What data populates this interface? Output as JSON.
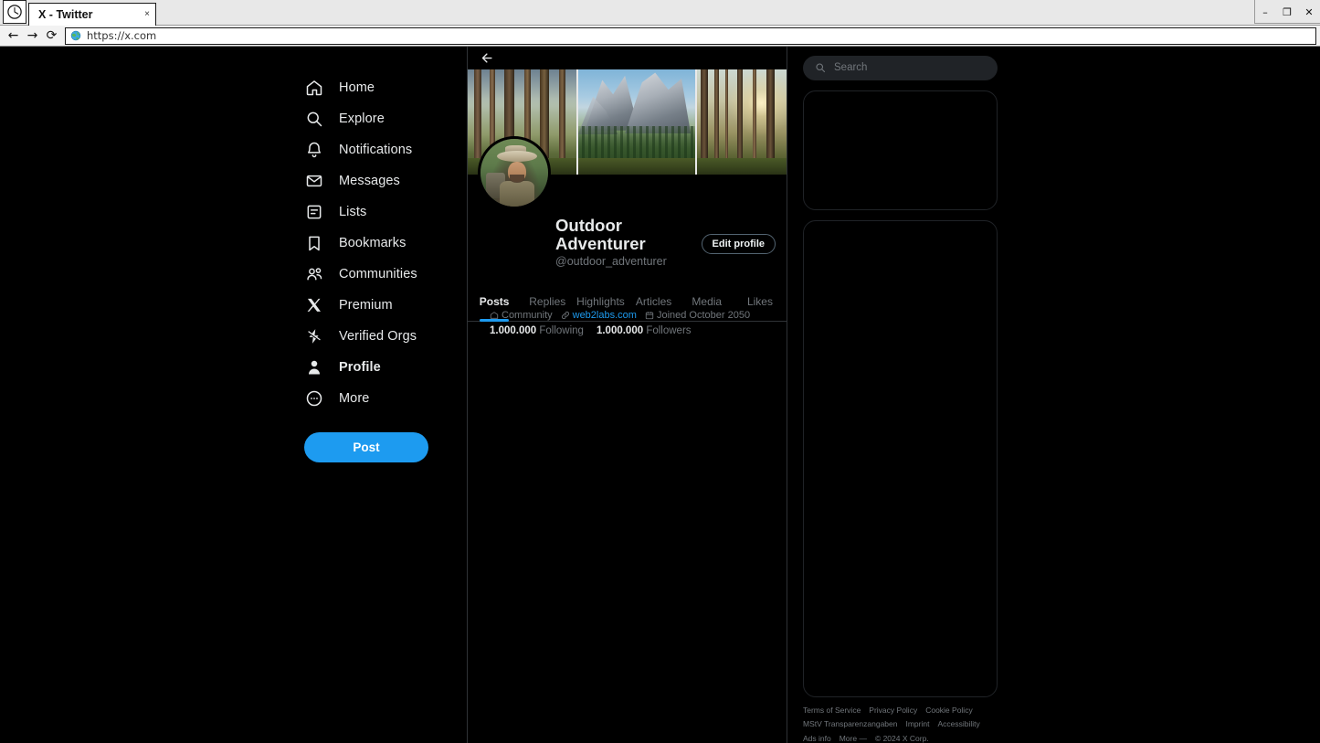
{
  "browser": {
    "app_icon": "clock-icon",
    "tab_title": "X - Twitter",
    "tab_close": "×",
    "url": "https://x.com",
    "back_icon": "←",
    "forward_icon": "→",
    "reload_icon": "⟳",
    "minimize": "–",
    "maximize": "❐",
    "close": "✕"
  },
  "sidebar": {
    "items": [
      {
        "label": "Home",
        "icon": "home-icon",
        "active": false
      },
      {
        "label": "Explore",
        "icon": "search-icon",
        "active": false
      },
      {
        "label": "Notifications",
        "icon": "bell-icon",
        "active": false
      },
      {
        "label": "Messages",
        "icon": "envelope-icon",
        "active": false
      },
      {
        "label": "Lists",
        "icon": "list-icon",
        "active": false
      },
      {
        "label": "Bookmarks",
        "icon": "bookmark-icon",
        "active": false
      },
      {
        "label": "Communities",
        "icon": "people-icon",
        "active": false
      },
      {
        "label": "Premium",
        "icon": "x-logo-icon",
        "active": false
      },
      {
        "label": "Verified Orgs",
        "icon": "lightning-badge-icon",
        "active": false
      },
      {
        "label": "Profile",
        "icon": "person-icon",
        "active": true
      },
      {
        "label": "More",
        "icon": "more-circle-icon",
        "active": false
      }
    ],
    "post_label": "Post"
  },
  "profile": {
    "back_icon": "back-arrow-icon",
    "banner_alt": "forest-and-mountain-banner",
    "avatar_alt": "outdoor-adventurer-avatar",
    "display_name": "Outdoor Adventurer",
    "handle": "@outdoor_adventurer",
    "edit_profile_label": "Edit profile",
    "meta": {
      "community_label": "Community",
      "community_icon": "community-icon",
      "website": "web2labs.com",
      "website_icon": "link-icon",
      "joined": "Joined October 2050",
      "joined_icon": "calendar-icon"
    },
    "counts": {
      "following_value": "1.000.000",
      "following_label": "Following",
      "followers_value": "1.000.000",
      "followers_label": "Followers"
    },
    "tabs": [
      {
        "label": "Posts",
        "active": true
      },
      {
        "label": "Replies",
        "active": false
      },
      {
        "label": "Highlights",
        "active": false
      },
      {
        "label": "Articles",
        "active": false
      },
      {
        "label": "Media",
        "active": false
      },
      {
        "label": "Likes",
        "active": false
      }
    ]
  },
  "right": {
    "search_placeholder": "Search",
    "search_value": "",
    "search_icon": "search-icon",
    "footer": [
      "Terms of Service",
      "Privacy Policy",
      "Cookie Policy",
      "MStV Transparenzangaben",
      "Imprint",
      "Accessibility",
      "Ads info",
      "More —"
    ],
    "copyright": "© 2024 X Corp."
  },
  "colors": {
    "accent": "#1d9bf0",
    "background": "#000000",
    "text_primary": "#e7e9ea",
    "text_secondary": "#71767b",
    "border": "#2f3336"
  }
}
